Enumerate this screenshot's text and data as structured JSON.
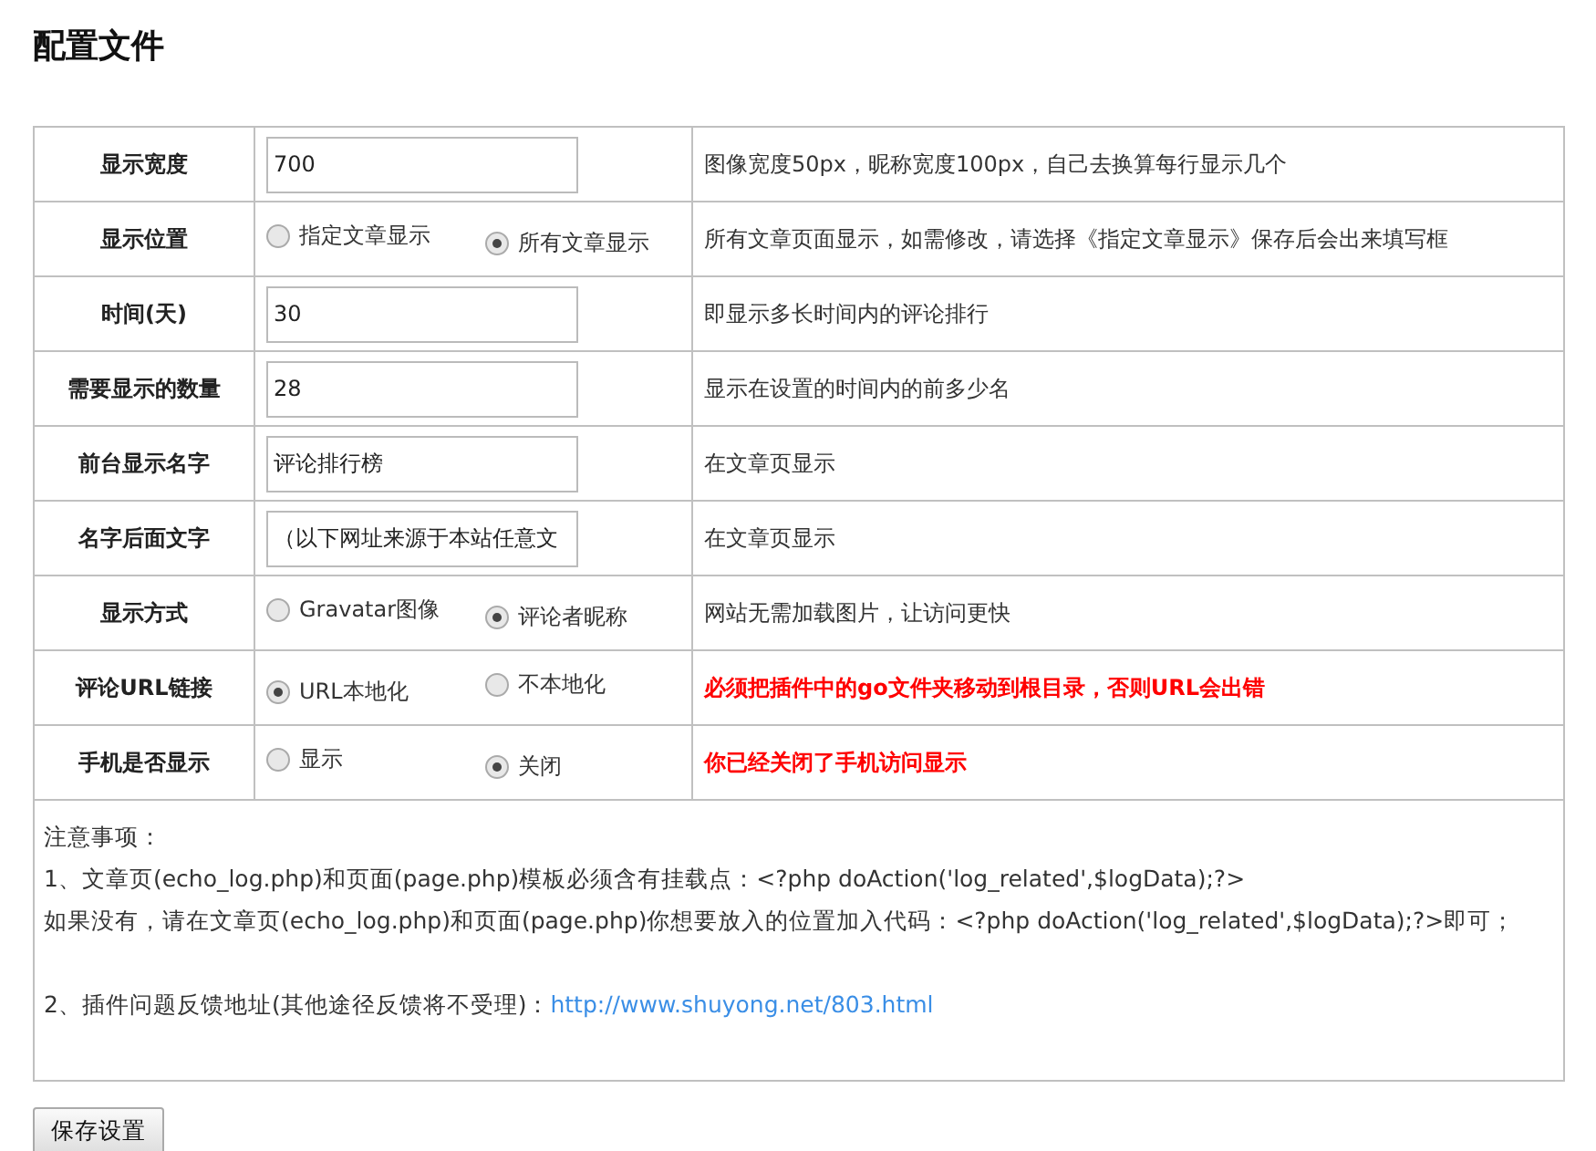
{
  "title": "配置文件",
  "rows": [
    {
      "label": "显示宽度",
      "kind": "text",
      "value": "700",
      "description": "图像宽度50px，昵称宽度100px，自己去换算每行显示几个",
      "warning": false
    },
    {
      "label": "显示位置",
      "kind": "radio",
      "options": [
        {
          "label": "指定文章显示",
          "selected": false
        },
        {
          "label": "所有文章显示",
          "selected": true
        }
      ],
      "description": "所有文章页面显示，如需修改，请选择《指定文章显示》保存后会出来填写框",
      "warning": false
    },
    {
      "label": "时间(天)",
      "kind": "text",
      "value": "30",
      "description": "即显示多长时间内的评论排行",
      "warning": false
    },
    {
      "label": "需要显示的数量",
      "kind": "text",
      "value": "28",
      "description": "显示在设置的时间内的前多少名",
      "warning": false
    },
    {
      "label": "前台显示名字",
      "kind": "text",
      "value": "评论排行榜",
      "description": "在文章页显示",
      "warning": false
    },
    {
      "label": "名字后面文字",
      "kind": "text",
      "value": "（以下网址来源于本站任意文",
      "description": "在文章页显示",
      "warning": false
    },
    {
      "label": "显示方式",
      "kind": "radio",
      "options": [
        {
          "label": "Gravatar图像",
          "selected": false
        },
        {
          "label": "评论者昵称",
          "selected": true
        }
      ],
      "description": "网站无需加载图片，让访问更快",
      "warning": false
    },
    {
      "label": "评论URL链接",
      "kind": "radio",
      "options": [
        {
          "label": "URL本地化",
          "selected": true
        },
        {
          "label": "不本地化",
          "selected": false
        }
      ],
      "description": "必须把插件中的go文件夹移动到根目录，否则URL会出错",
      "warning": true
    },
    {
      "label": "手机是否显示",
      "kind": "radio",
      "options": [
        {
          "label": "显示",
          "selected": false
        },
        {
          "label": "关闭",
          "selected": true
        }
      ],
      "description": "你已经关闭了手机访问显示",
      "warning": true
    }
  ],
  "notes": {
    "heading": "注意事项：",
    "lines": [
      "1、文章页(echo_log.php)和页面(page.php)模板必须含有挂载点：<?php doAction('log_related',$logData);?>",
      "如果没有，请在文章页(echo_log.php)和页面(page.php)你想要放入的位置加入代码：<?php doAction('log_related',$logData);?>即可；"
    ],
    "feedback": {
      "text": "2、插件问题反馈地址(其他途径反馈将不受理)：",
      "link": "http://www.shuyong.net/803.html"
    }
  },
  "save_button": "保存设置"
}
